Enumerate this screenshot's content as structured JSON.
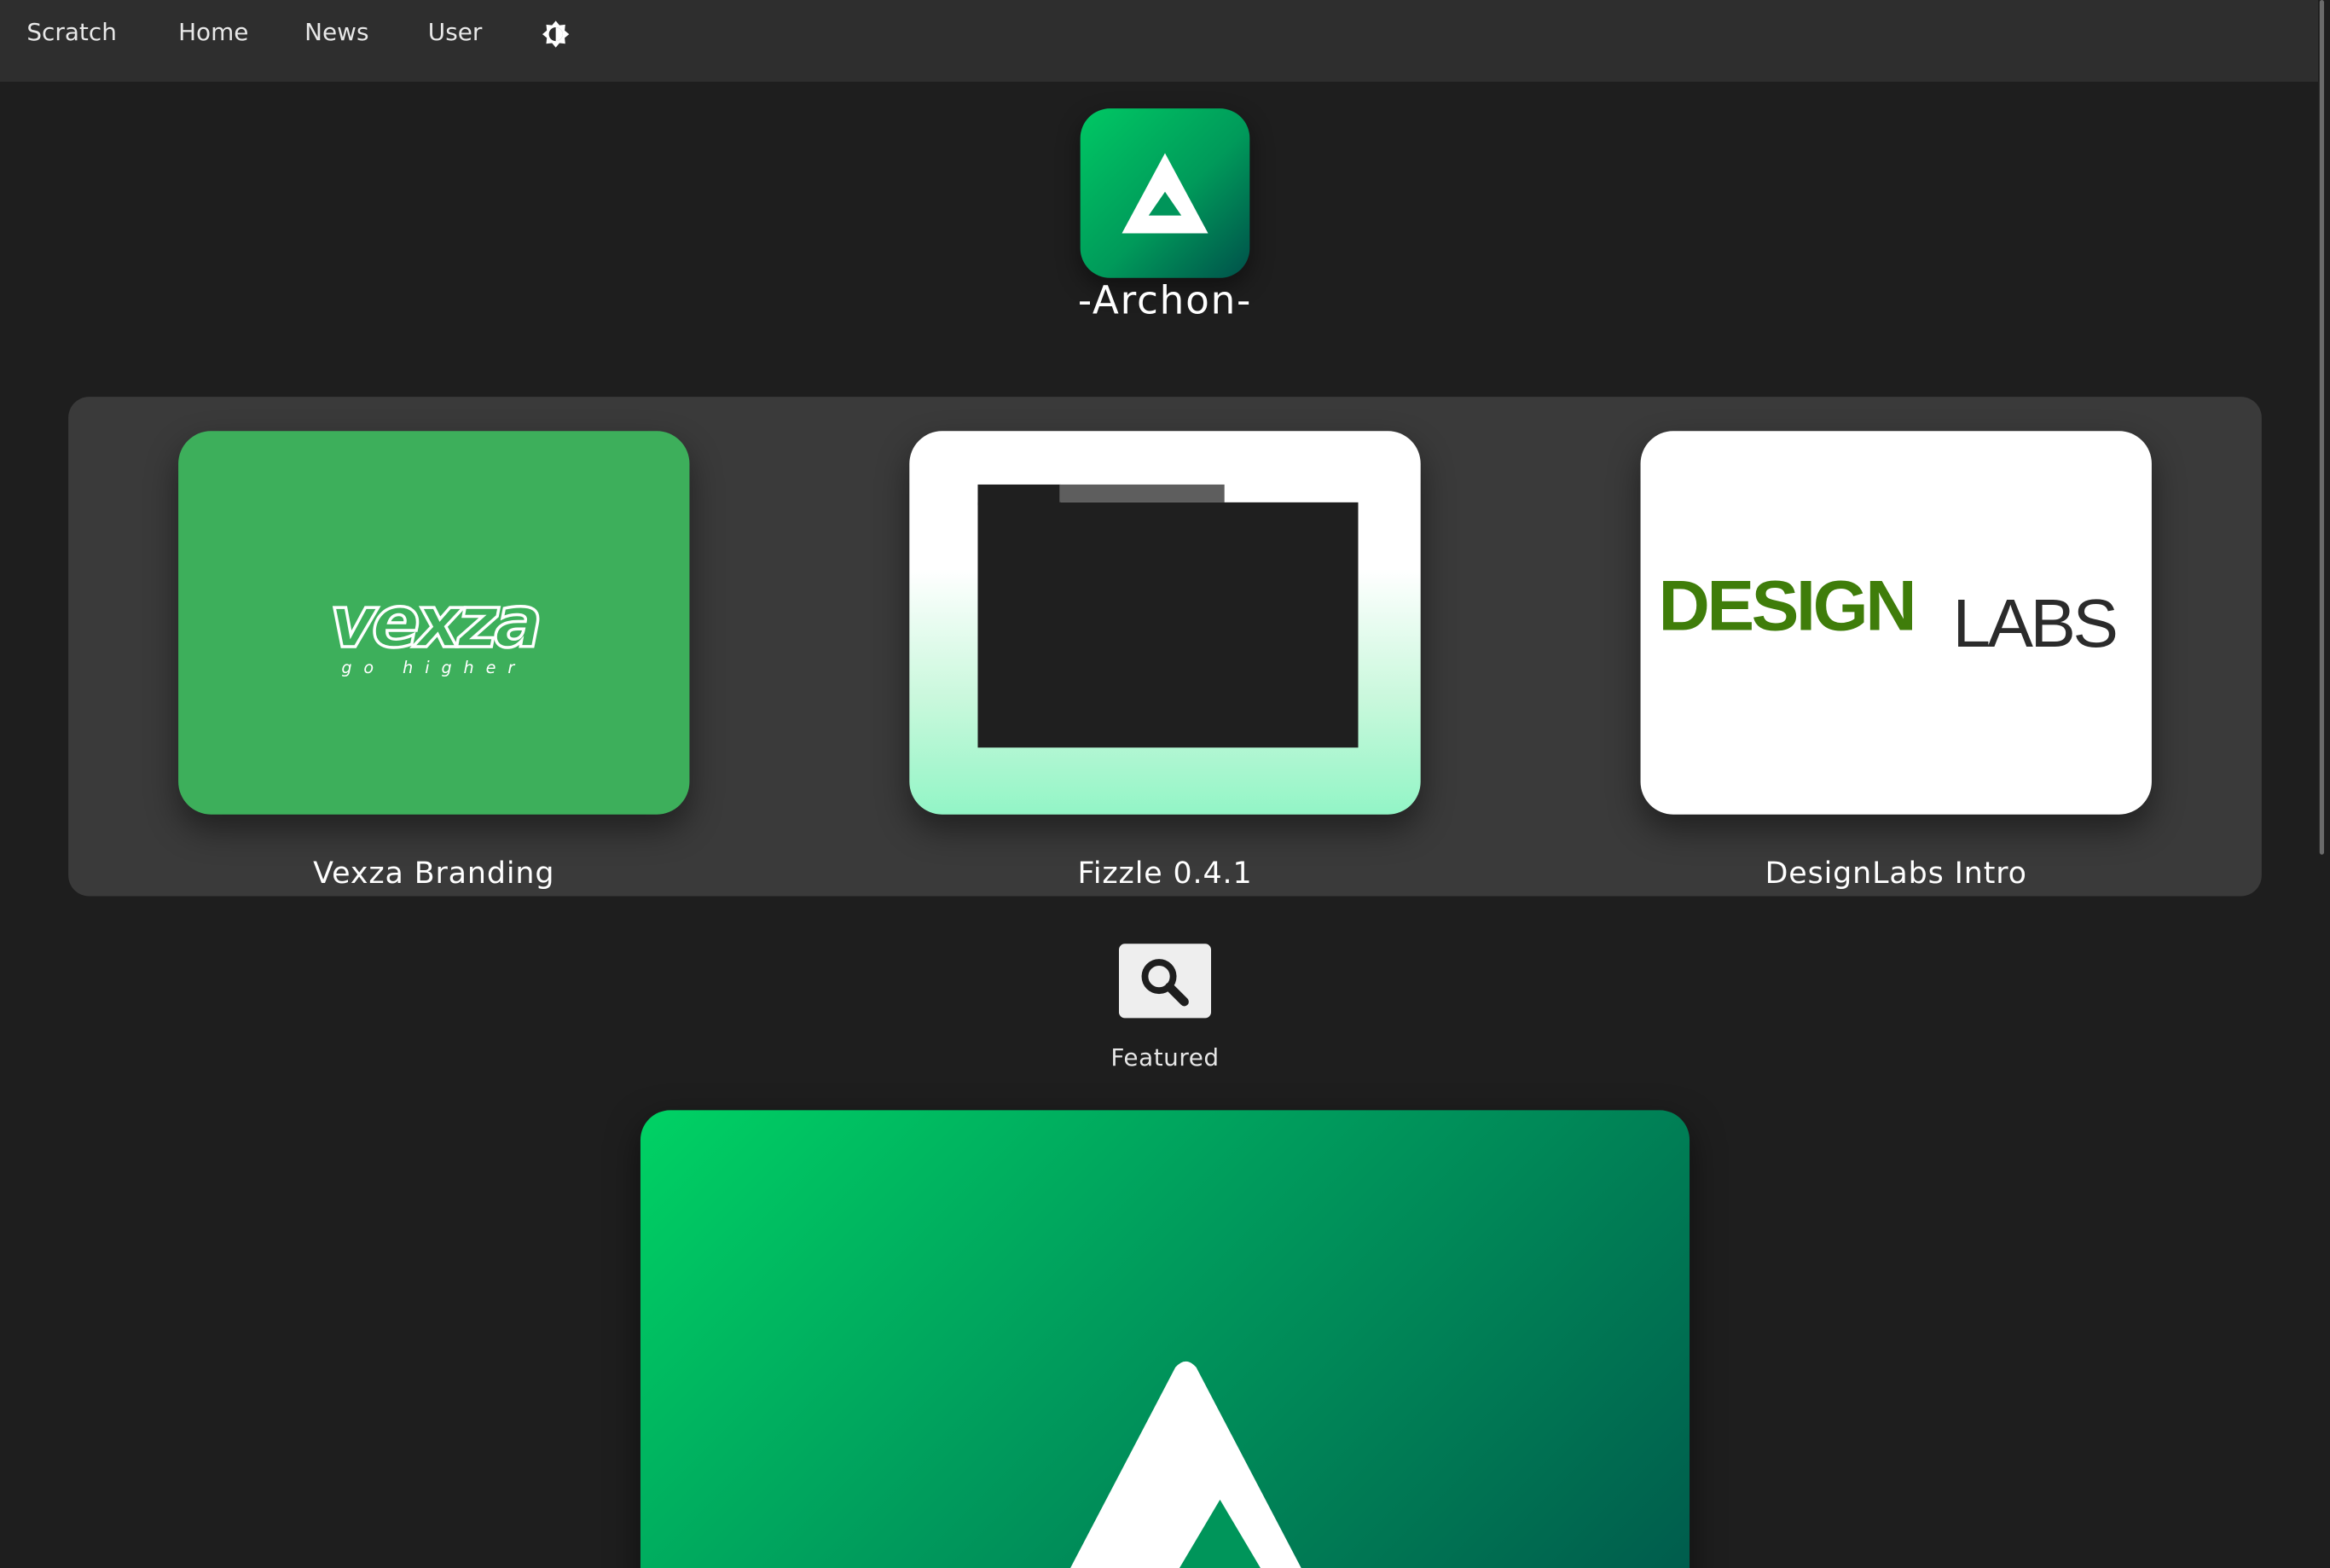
{
  "nav": {
    "items": [
      {
        "label": "Scratch"
      },
      {
        "label": "Home"
      },
      {
        "label": "News"
      },
      {
        "label": "User"
      }
    ],
    "theme_toggle_icon": "brightness-icon"
  },
  "app": {
    "name": "-Archon-",
    "logo_icon": "archon-logo-icon",
    "accent_colors": [
      "#00c864",
      "#00504a"
    ]
  },
  "carousel": {
    "cards": [
      {
        "title": "Vexza Branding",
        "logo_word": "vexza",
        "logo_tagline": "go higher",
        "background": "#3daf5b"
      },
      {
        "title": "Fizzle 0.4.1",
        "background": "#92f5c6"
      },
      {
        "title": "DesignLabs Intro",
        "logo_word_1": "DESIGN",
        "logo_word_2": "LABS",
        "logo_color_1": "#3f7d0a",
        "logo_color_2": "#2b2b2b"
      }
    ]
  },
  "search": {
    "icon": "search-icon",
    "label": "Featured"
  },
  "featured": {
    "logo_icon": "archon-logo-icon"
  }
}
